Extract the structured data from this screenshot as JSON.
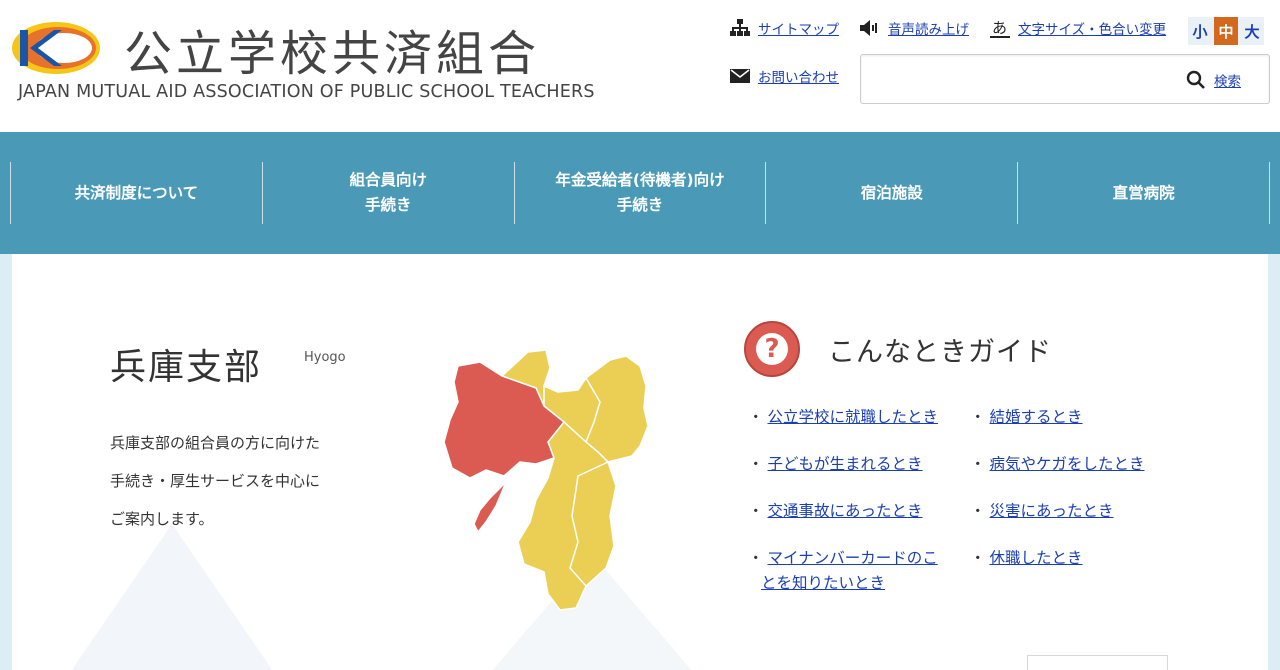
{
  "header": {
    "logo_title": "公立学校共済組合",
    "logo_subtitle": "JAPAN MUTUAL AID ASSOCIATION OF PUBLIC SCHOOL TEACHERS",
    "logo_colors": {
      "orange": "#e8722a",
      "yellow": "#f5c518",
      "blue": "#1b56a6"
    },
    "utility": {
      "sitemap": "サイトマップ",
      "voice": "音声読み上げ",
      "fontsize_color": "文字サイズ・色合い変更",
      "contact": "お問い合わせ"
    },
    "font_size": {
      "small": "小",
      "medium": "中",
      "large": "大",
      "selected": "中"
    },
    "search": {
      "value": "",
      "placeholder": "",
      "button": "検索"
    }
  },
  "nav": {
    "items": [
      {
        "line1": "共済制度について",
        "line2": ""
      },
      {
        "line1": "組合員向け",
        "line2": "手続き"
      },
      {
        "line1": "年金受給者(待機者)向け",
        "line2": "手続き"
      },
      {
        "line1": "宿泊施設",
        "line2": ""
      },
      {
        "line1": "直営病院",
        "line2": ""
      }
    ],
    "color": "#4a9ab7"
  },
  "branch": {
    "title": "兵庫支部",
    "title_en": "Hyogo",
    "desc": [
      "兵庫支部の組合員の方に向けた",
      "手続き・厚生サービスを中心に",
      "ご案内します。"
    ],
    "map_colors": {
      "highlight": "#db5a51",
      "base": "#ebcf55"
    }
  },
  "guide": {
    "title": "こんなときガイド",
    "icon": "question-icon",
    "links": [
      {
        "line1": "公立学校に就職したとき",
        "line2": ""
      },
      {
        "line1": "結婚するとき",
        "line2": ""
      },
      {
        "line1": "子どもが生まれるとき",
        "line2": ""
      },
      {
        "line1": "病気やケガをしたとき",
        "line2": ""
      },
      {
        "line1": "交通事故にあったとき",
        "line2": ""
      },
      {
        "line1": "災害にあったとき",
        "line2": ""
      },
      {
        "line1": "マイナンバーカードのこ",
        "line2": "とを知りたいとき"
      },
      {
        "line1": "休職したとき",
        "line2": ""
      }
    ]
  }
}
